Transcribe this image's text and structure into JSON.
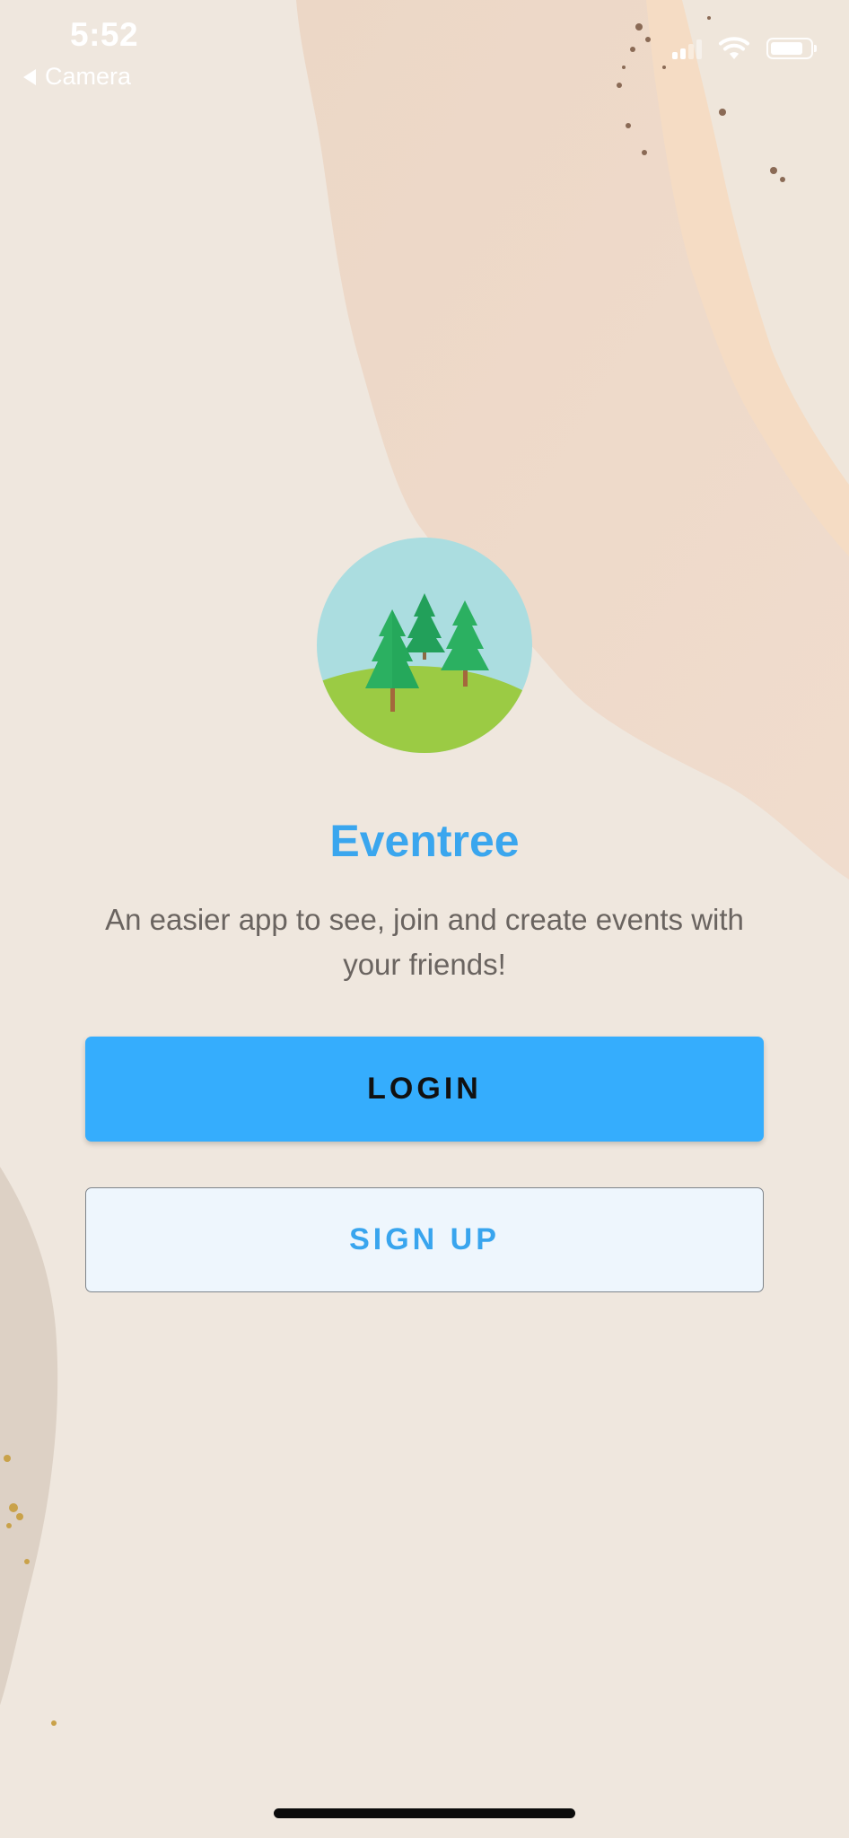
{
  "status_bar": {
    "time": "5:52",
    "back_label": "Camera",
    "battery_level": 0.85,
    "icons": [
      "signal-icon",
      "wifi-icon",
      "battery-icon"
    ]
  },
  "app": {
    "logo_icon": "forest-trees-logo",
    "title": "Eventree",
    "tagline": "An easier app to see, join and create events with your friends!"
  },
  "buttons": {
    "login_label": "LOGIN",
    "signup_label": "SIGN UP"
  },
  "colors": {
    "accent": "#35adfd",
    "title": "#3aa6ee",
    "signup_bg": "#eef6fd"
  }
}
